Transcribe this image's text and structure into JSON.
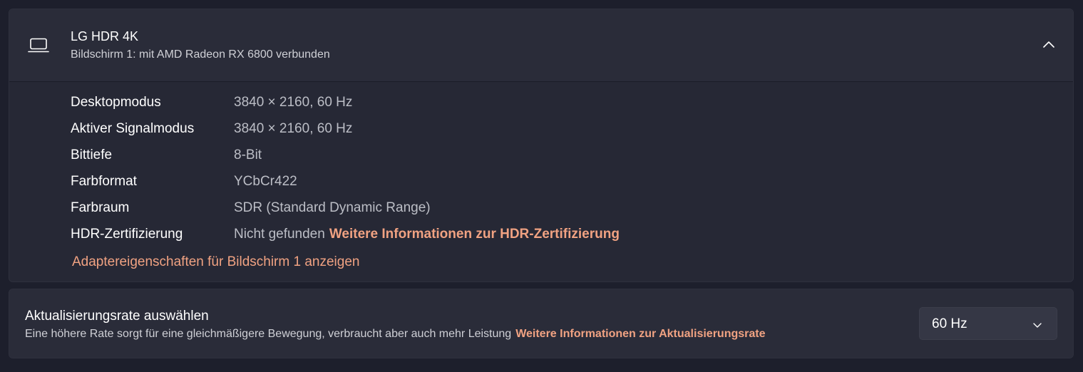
{
  "display": {
    "icon": "laptop-monitor-icon",
    "title": "LG HDR 4K",
    "subtitle": "Bildschirm 1: mit AMD Radeon RX 6800 verbunden",
    "collapse_icon": "chevron-up-icon",
    "rows": [
      {
        "label": "Desktopmodus",
        "value": "3840 × 2160, 60 Hz"
      },
      {
        "label": "Aktiver Signalmodus",
        "value": "3840 × 2160, 60 Hz"
      },
      {
        "label": "Bittiefe",
        "value": "8-Bit"
      },
      {
        "label": "Farbformat",
        "value": "YCbCr422"
      },
      {
        "label": "Farbraum",
        "value": "SDR (Standard Dynamic Range)"
      },
      {
        "label": "HDR-Zertifizierung",
        "value": "Nicht gefunden",
        "link": "Weitere Informationen zur HDR-Zertifizierung"
      }
    ],
    "adapter_link": "Adaptereigenschaften für Bildschirm 1 anzeigen"
  },
  "refresh": {
    "title": "Aktualisierungsrate auswählen",
    "description": "Eine höhere Rate sorgt für eine gleichmäßigere Bewegung, verbraucht aber auch mehr Leistung",
    "link": "Weitere Informationen zur Aktualisierungsrate",
    "selected": "60 Hz",
    "dropdown_icon": "chevron-down-icon"
  },
  "colors": {
    "accent_link": "#f0a282",
    "background": "#1d1f2c",
    "card": "#2a2c39"
  }
}
